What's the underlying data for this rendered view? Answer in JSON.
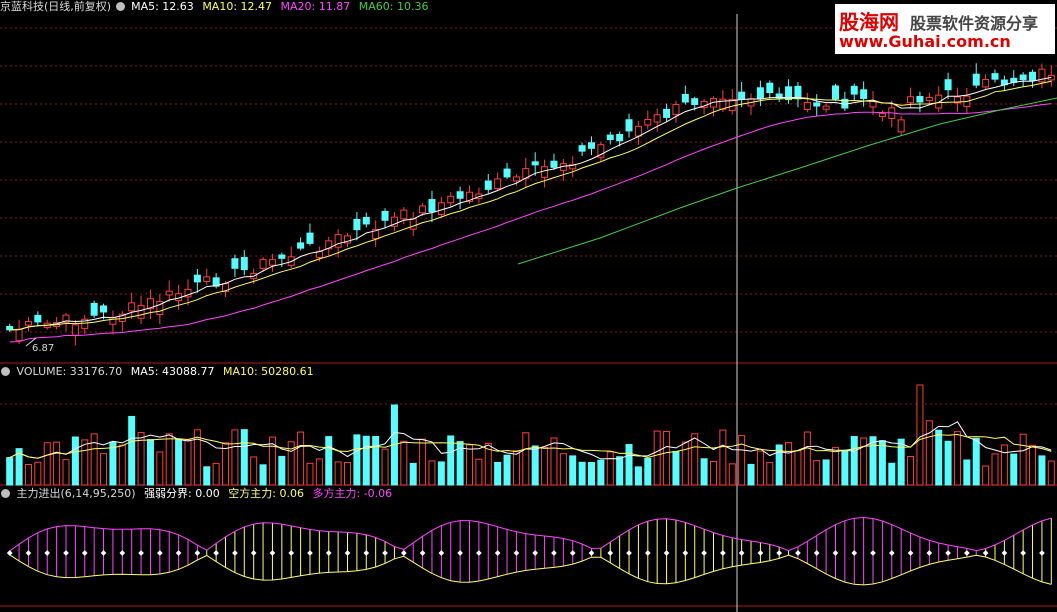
{
  "colors": {
    "up": "#ff3c3c",
    "down": "#54ffff",
    "ma5": "#ffffff",
    "ma10": "#ffff55",
    "ma20": "#ff44ff",
    "ma60": "#3fcf3f",
    "grid": "#8a1414",
    "divider": "#b01a1a",
    "text": "#d8d8d8",
    "kong": "#ffff66",
    "duo": "#ff44ff",
    "qiang": "#ffffff"
  },
  "price_panel": {
    "title": "京蓝科技(日线,前复权)",
    "ma5_label": "MA5: 12.63",
    "ma10_label": "MA10: 12.47",
    "ma20_label": "MA20: 11.87",
    "ma60_label": "MA60: 10.36",
    "low_label": "6.87",
    "settings_icon": "gear-icon"
  },
  "volume_panel": {
    "title": "VOLUME: 33176.70",
    "ma5_label": "MA5: 43088.77",
    "ma10_label": "MA10: 50280.61"
  },
  "indicator_panel": {
    "title": "主力进出(6,14,95,250)",
    "strong_weak_label": "强弱分界: 0.00",
    "kong_label": "空方主力: 0.06",
    "duo_label": "多方主力: -0.06"
  },
  "watermark": {
    "brand": "股海网",
    "slogan": "股票软件资源分享",
    "url": "www.Guhai.com.cn"
  },
  "chart_data": {
    "type": "candlestick",
    "symbol": "京蓝科技",
    "period": "日线,前复权",
    "ma_last": {
      "MA5": 12.63,
      "MA10": 12.47,
      "MA20": 11.87,
      "MA60": 10.36
    },
    "price_low_marker": 6.87,
    "volume_last": {
      "VOLUME": 33176.7,
      "MA5": 43088.77,
      "MA10": 50280.61
    },
    "indicator_last": {
      "强弱分界": 0.0,
      "空方主力": 0.06,
      "多方主力": -0.06
    }
  }
}
